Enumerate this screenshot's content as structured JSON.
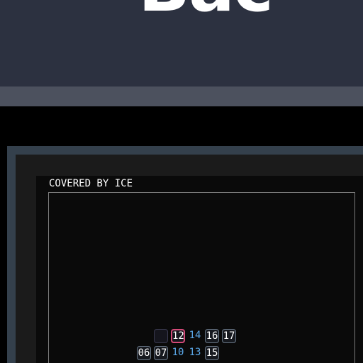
{
  "banner": {
    "title": "Bac"
  },
  "panel": {
    "title": "COVERED BY ICE"
  },
  "tiles_row1": [
    "",
    "12",
    "14",
    "16",
    "17"
  ],
  "tiles_row2": [
    "06",
    "07",
    "10",
    "13",
    "15"
  ],
  "colors": {
    "banner_bg": "#2c3140",
    "frame": "#34404c",
    "highlight_red": "#d44a78",
    "highlight_blue": "#5aa6e6"
  }
}
